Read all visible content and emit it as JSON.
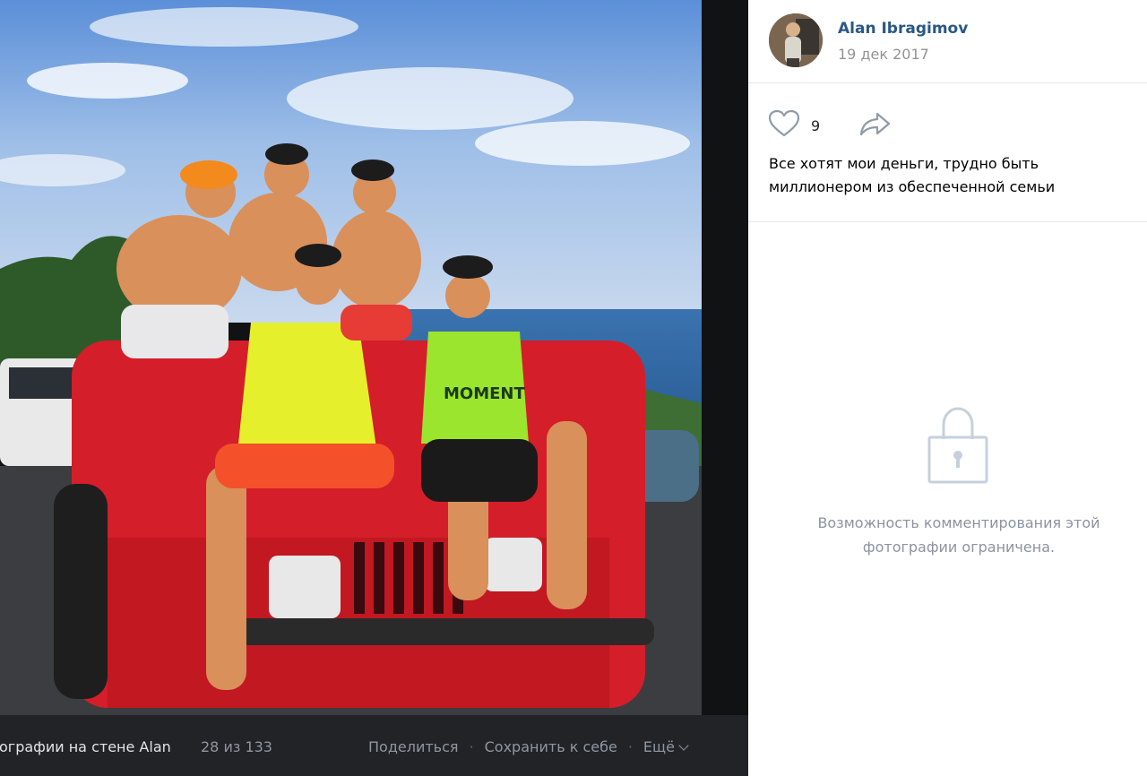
{
  "bottom_bar": {
    "album_label": "ографии на стене Alan",
    "counter": "28 из 133",
    "share_label": "Поделиться",
    "separator": "·",
    "save_label": "Сохранить к себе",
    "more_label": "Ещё"
  },
  "author": {
    "name": "Alan Ibragimov",
    "date": "19 дек 2017"
  },
  "likes": {
    "count": "9"
  },
  "caption": "Все хотят мои деньги, трудно быть миллионером из обеспеченной семьи",
  "comments": {
    "restricted_text": "Возможность комментирования этой фотографии ограничена."
  },
  "colors": {
    "link": "#2a5885",
    "muted": "#939393",
    "bar_bg": "#222327",
    "icon": "#8e9aa8"
  },
  "icons": [
    "heart-icon",
    "share-arrow-icon",
    "lock-icon",
    "chevron-down-icon"
  ]
}
